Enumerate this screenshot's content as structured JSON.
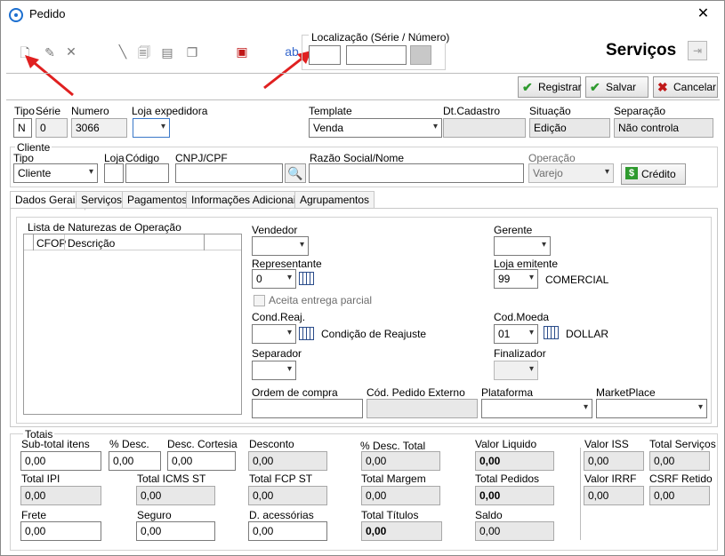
{
  "window": {
    "title": "Pedido"
  },
  "toolbar": {
    "icons": [
      "new-document-icon",
      "edit-icon",
      "delete-icon",
      "pen-icon",
      "preview-icon",
      "print-icon",
      "copy-icon",
      "export-icon",
      "spellcheck-icon"
    ],
    "localizacao_label": "Localização (Série / Número)",
    "serie_value": "",
    "numero_value": "",
    "servicos_title": "Serviços",
    "registrar_label": "Registrar",
    "salvar_label": "Salvar",
    "cancelar_label": "Cancelar"
  },
  "header": {
    "tipo_label": "Tipo",
    "serie_label": "Série",
    "numero_label": "Numero",
    "loja_expedidora_label": "Loja expedidora",
    "template_label": "Template",
    "dt_cadastro_label": "Dt.Cadastro",
    "situacao_label": "Situação",
    "separacao_label": "Separação",
    "tipo_value": "N",
    "serie_value": "0",
    "numero_value": "3066",
    "loja_expedidora_value": "",
    "template_value": "Venda",
    "dt_cadastro_value": "",
    "situacao_value": "Edição",
    "separacao_value": "Não controla"
  },
  "cliente": {
    "group_title": "Cliente",
    "tipo_label": "Tipo",
    "loja_label": "Loja",
    "codigo_label": "Código",
    "cnpj_label": "CNPJ/CPF",
    "razao_label": "Razão Social/Nome",
    "operacao_label": "Operação",
    "tipo_value": "Cliente",
    "operacao_value": "Varejo",
    "credito_label": "Crédito"
  },
  "tabs": [
    "Dados Gerais",
    "Serviços",
    "Pagamentos",
    "Informações Adicionais",
    "Agrupamentos"
  ],
  "dados_gerais": {
    "lista_title": "Lista de Naturezas de Operação",
    "col_cfop": "CFOP",
    "col_descricao": "Descrição",
    "vendedor_label": "Vendedor",
    "representante_label": "Representante",
    "representante_value": "0",
    "aceita_label": "Aceita entrega parcial",
    "cond_reaj_label": "Cond.Reaj.",
    "cond_reaj_desc": "Condição de Reajuste",
    "separador_label": "Separador",
    "ordem_compra_label": "Ordem de compra",
    "cod_pedido_label": "Cód. Pedido Externo",
    "plataforma_label": "Plataforma",
    "marketplace_label": "MarketPlace",
    "gerente_label": "Gerente",
    "loja_emitente_label": "Loja emitente",
    "loja_emitente_value": "99",
    "loja_emitente_desc": "COMERCIAL",
    "cod_moeda_label": "Cod.Moeda",
    "cod_moeda_value": "01",
    "cod_moeda_desc": "DOLLAR",
    "finalizador_label": "Finalizador"
  },
  "totais": {
    "group_title": "Totais",
    "subtotal_itens": {
      "label": "Sub-total itens",
      "value": "0,00"
    },
    "pct_desc": {
      "label": "% Desc.",
      "value": "0,00"
    },
    "desc_cortesia": {
      "label": "Desc. Cortesia",
      "value": "0,00"
    },
    "desconto": {
      "label": "Desconto",
      "value": "0,00"
    },
    "pct_desc_total": {
      "label": "% Desc. Total",
      "value": "0,00"
    },
    "valor_liquido": {
      "label": "Valor Liquido",
      "value": "0,00"
    },
    "valor_iss": {
      "label": "Valor ISS",
      "value": "0,00"
    },
    "total_servicos": {
      "label": "Total Serviços",
      "value": "0,00"
    },
    "total_ipi": {
      "label": "Total IPI",
      "value": "0,00"
    },
    "total_icms_st": {
      "label": "Total ICMS ST",
      "value": "0,00"
    },
    "total_fcp_st": {
      "label": "Total FCP ST",
      "value": "0,00"
    },
    "total_margem": {
      "label": "Total Margem",
      "value": "0,00"
    },
    "total_pedidos": {
      "label": "Total Pedidos",
      "value": "0,00"
    },
    "valor_irrf": {
      "label": "Valor IRRF",
      "value": "0,00"
    },
    "csrf_retido": {
      "label": "CSRF Retido",
      "value": "0,00"
    },
    "frete": {
      "label": "Frete",
      "value": "0,00"
    },
    "seguro": {
      "label": "Seguro",
      "value": "0,00"
    },
    "d_acessorias": {
      "label": "D. acessórias",
      "value": "0,00"
    },
    "total_titulos": {
      "label": "Total Títulos",
      "value": "0,00"
    },
    "saldo": {
      "label": "Saldo",
      "value": "0,00"
    }
  },
  "colors": {
    "annotation_arrow": "#e02020",
    "button_green": "#2e9a2e",
    "cancel_red": "#c01818"
  }
}
